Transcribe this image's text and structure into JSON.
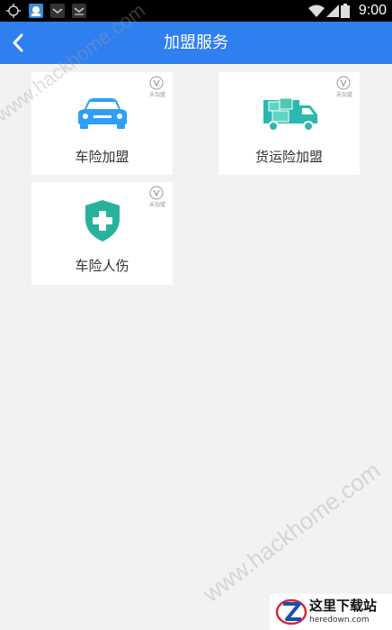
{
  "status_bar": {
    "time": "9:00"
  },
  "app_bar": {
    "title": "加盟服务"
  },
  "cards": [
    {
      "label": "车险加盟",
      "badge": "未加盟",
      "icon": "car-icon",
      "icon_color": "#2f9ff5"
    },
    {
      "label": "货运险加盟",
      "badge": "未加盟",
      "icon": "truck-icon",
      "icon_color": "#2cb8b0"
    },
    {
      "label": "车险人伤",
      "badge": "未加盟",
      "icon": "medical-shield-icon",
      "icon_color": "#27b39b"
    }
  ],
  "watermark": {
    "text": "www.hackhome.com",
    "site_name": "这里下载站",
    "site_url": "heredown.com"
  },
  "colors": {
    "app_bar": "#2f7ff0",
    "background": "#f2f2f2",
    "card": "#ffffff"
  }
}
